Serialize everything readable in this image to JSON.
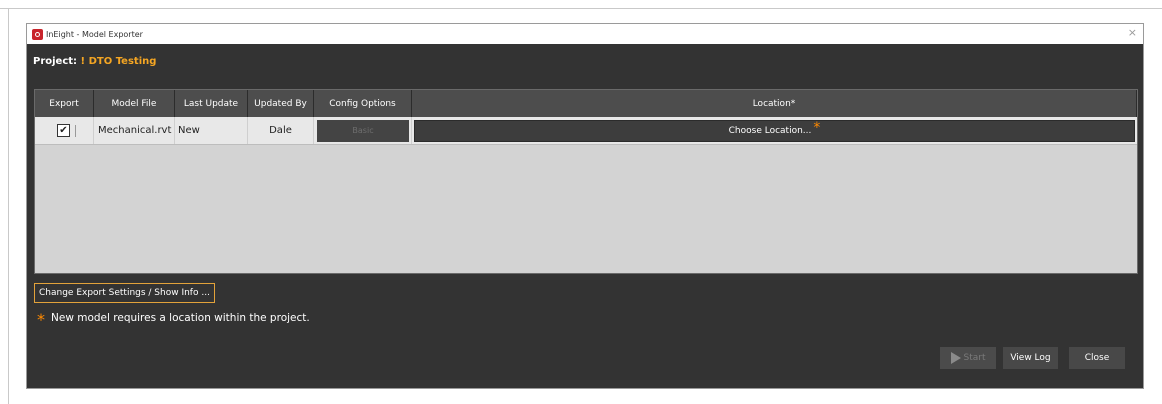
{
  "window": {
    "title": "InEight - Model Exporter",
    "close_glyph": "×"
  },
  "project": {
    "label": "Project:",
    "name": "! DTO Testing"
  },
  "table": {
    "headers": [
      "Export",
      "Model File",
      "Last Update",
      "Updated By",
      "Config Options",
      "Location*"
    ],
    "rows": [
      {
        "export_checked": true,
        "check_glyph": "✔",
        "model_file": "Mechanical.rvt",
        "last_update": "New",
        "updated_by": "Dale",
        "config_options": "Basic",
        "location": "Choose Location...",
        "location_marker": "*"
      }
    ]
  },
  "settings_button": "Change Export Settings / Show Info ...",
  "note": {
    "marker": "*",
    "text": "New model requires a location within the project."
  },
  "buttons": {
    "start": "Start",
    "view_log": "View Log",
    "close": "Close"
  },
  "colors": {
    "accent": "#f5a623",
    "required_marker": "#ff8a00",
    "dialog_bg": "#333333",
    "grid_bg": "#d3d3d3"
  },
  "icons": {
    "app": "inEight-logo-icon",
    "start": "play-icon"
  }
}
